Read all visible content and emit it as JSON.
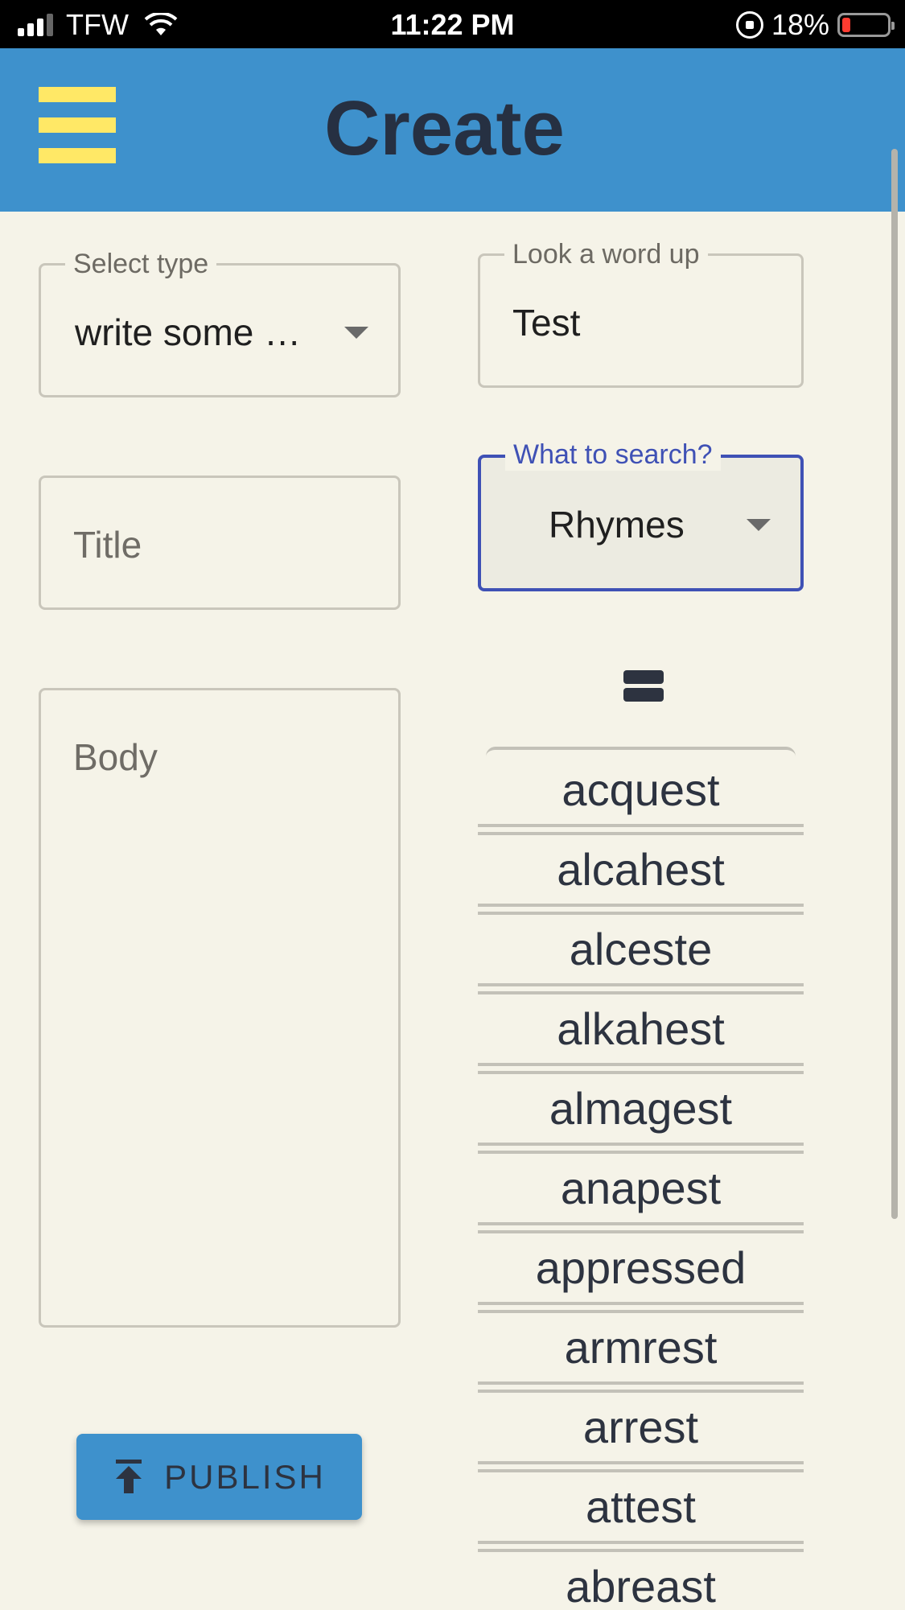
{
  "status_bar": {
    "carrier": "TFW",
    "time": "11:22 PM",
    "battery": "18%",
    "battery_level_percent": 18
  },
  "app_bar": {
    "title": "Create",
    "menu_icon": "hamburger-menu-icon"
  },
  "form": {
    "select_type": {
      "label": "Select type",
      "value": "write some …"
    },
    "title": {
      "placeholder": "Title"
    },
    "body": {
      "placeholder": "Body"
    },
    "publish": {
      "label": "PUBLISH",
      "icon": "upload-icon"
    }
  },
  "lookup": {
    "label": "Look a word up",
    "value": "Test",
    "search_type": {
      "label": "What to search?",
      "value": "Rhymes"
    },
    "drag_icon": "drag-handle-icon",
    "results": [
      "acquest",
      "alcahest",
      "alceste",
      "alkahest",
      "almagest",
      "anapest",
      "appressed",
      "armrest",
      "arrest",
      "attest",
      "abreast"
    ]
  },
  "colors": {
    "app_bar": "#3e91cc",
    "menu_icon": "#ffe866",
    "background": "#f5f3e8",
    "focus": "#3f51b5",
    "text_dark": "#2d3340"
  }
}
